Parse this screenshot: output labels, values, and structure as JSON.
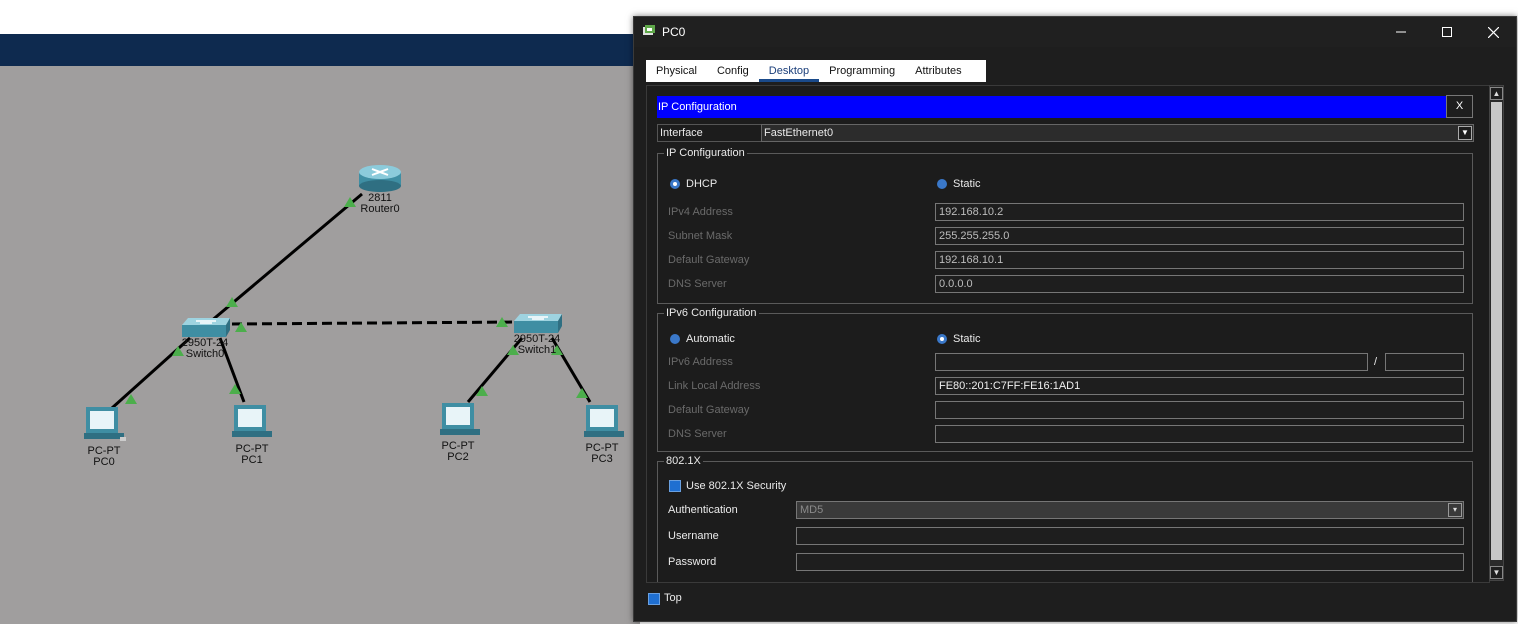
{
  "devices": {
    "router0": {
      "model": "2811",
      "name": "Router0"
    },
    "switch0": {
      "model": "2950T-24",
      "name": "Switch0"
    },
    "switch1": {
      "model": "2950T-24",
      "name": "Switch1"
    },
    "pc0": {
      "model": "PC-PT",
      "name": "PC0"
    },
    "pc1": {
      "model": "PC-PT",
      "name": "PC1"
    },
    "pc2": {
      "model": "PC-PT",
      "name": "PC2"
    },
    "pc3": {
      "model": "PC-PT",
      "name": "PC3"
    }
  },
  "window": {
    "title": "PC0",
    "minimize": "—",
    "maximize": "☐",
    "close": "✕"
  },
  "tabs": [
    "Physical",
    "Config",
    "Desktop",
    "Programming",
    "Attributes"
  ],
  "active_tab": "Desktop",
  "ip_config": {
    "title": "IP Configuration",
    "close_label": "X",
    "interface_label": "Interface",
    "interface_value": "FastEthernet0",
    "ipv4_group": "IP Configuration",
    "dhcp_label": "DHCP",
    "static_label": "Static",
    "ipv4_address_label": "IPv4 Address",
    "ipv4_address": "192.168.10.2",
    "subnet_mask_label": "Subnet Mask",
    "subnet_mask": "255.255.255.0",
    "gateway_label": "Default Gateway",
    "gateway": "192.168.10.1",
    "dns_label": "DNS Server",
    "dns": "0.0.0.0",
    "ipv6_group": "IPv6 Configuration",
    "automatic_label": "Automatic",
    "static6_label": "Static",
    "ipv6_address_label": "IPv6 Address",
    "ipv6_address": "",
    "prefix_sep": "/",
    "ipv6_prefix": "",
    "link_local_label": "Link Local Address",
    "link_local": "FE80::201:C7FF:FE16:1AD1",
    "gateway6_label": "Default Gateway",
    "gateway6": "",
    "dns6_label": "DNS Server",
    "dns6": "",
    "dot1x_group": "802.1X",
    "use_8021x_label": "Use 802.1X Security",
    "auth_label": "Authentication",
    "auth_value": "MD5",
    "username_label": "Username",
    "username": "",
    "password_label": "Password",
    "password": ""
  },
  "footer": {
    "top_label": "Top"
  },
  "colors": {
    "canvas": "#a09e9e",
    "title_bar_blue": "#0000ff",
    "dialog_bg": "#1c1c1c",
    "link_green": "#4cae4c"
  }
}
